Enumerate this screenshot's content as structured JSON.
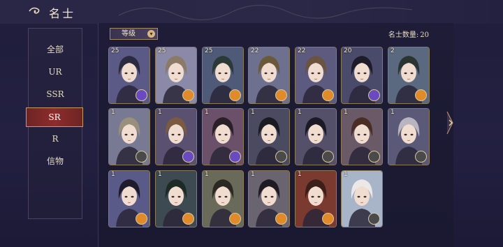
{
  "header": {
    "title": "名士"
  },
  "sidebar": {
    "items": [
      {
        "label": "全部",
        "active": false
      },
      {
        "label": "UR",
        "active": false
      },
      {
        "label": "SSR",
        "active": false
      },
      {
        "label": "SR",
        "active": true
      },
      {
        "label": "R",
        "active": false
      },
      {
        "label": "信物",
        "active": false
      }
    ]
  },
  "toolbar": {
    "sort_label": "等级",
    "count_label": "名士数量:",
    "count_value": "20"
  },
  "cards": [
    {
      "level": "25",
      "badge": "purple",
      "hair": "#2c2a3e",
      "bg": "#5b5a86"
    },
    {
      "level": "25",
      "badge": "orange",
      "hair": "#8a7a66",
      "bg": "#8a8aa8"
    },
    {
      "level": "25",
      "badge": "orange",
      "hair": "#2b3a36",
      "bg": "#4e5a78"
    },
    {
      "level": "22",
      "badge": "orange",
      "hair": "#6a5a3a",
      "bg": "#6e7090"
    },
    {
      "level": "22",
      "badge": "orange",
      "hair": "#6a5440",
      "bg": "#5c5a7e"
    },
    {
      "level": "20",
      "badge": "purple",
      "hair": "#1e1c28",
      "bg": "#4a4a6a"
    },
    {
      "level": "2",
      "badge": "orange",
      "hair": "#2a3430",
      "bg": "#5a6880"
    },
    {
      "level": "1",
      "badge": "grey",
      "hair": "#9a8e7c",
      "bg": "#777a92"
    },
    {
      "level": "1",
      "badge": "purple",
      "hair": "#7a5a40",
      "bg": "#5a5070"
    },
    {
      "level": "1",
      "badge": "purple",
      "hair": "#2a2028",
      "bg": "#6a5068"
    },
    {
      "level": "1",
      "badge": "grey",
      "hair": "#1a1a22",
      "bg": "#4a4a60"
    },
    {
      "level": "1",
      "badge": "grey",
      "hair": "#1c1a24",
      "bg": "#54506a"
    },
    {
      "level": "1",
      "badge": "grey",
      "hair": "#4a2e24",
      "bg": "#6a5a68"
    },
    {
      "level": "1",
      "badge": "grey",
      "hair": "#b8b4c0",
      "bg": "#5a5a78"
    },
    {
      "level": "1",
      "badge": "orange",
      "hair": "#1e1c2a",
      "bg": "#5a5a88"
    },
    {
      "level": "1",
      "badge": "orange",
      "hair": "#1e2a26",
      "bg": "#3e4a52"
    },
    {
      "level": "1",
      "badge": "orange",
      "hair": "#2a2a22",
      "bg": "#6a6a5a"
    },
    {
      "level": "1",
      "badge": "orange",
      "hair": "#1e1c22",
      "bg": "#6a6470"
    },
    {
      "level": "1",
      "badge": "orange",
      "hair": "#3a2018",
      "bg": "#7a3a30"
    },
    {
      "level": "1",
      "badge": "grey",
      "hair": "#ece8e8",
      "bg": "#a8b4c8"
    }
  ],
  "colors": {
    "accent": "#8d2c2c",
    "gold": "#c79a6a",
    "badge_orange": "#e08a2a",
    "badge_purple": "#6a4ac0",
    "badge_grey": "#4a4a4a"
  }
}
